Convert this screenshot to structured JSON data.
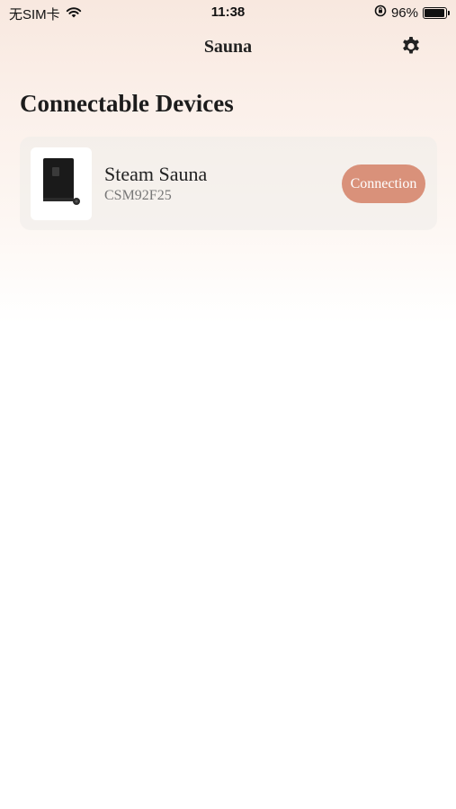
{
  "status_bar": {
    "carrier": "无SIM卡",
    "time": "11:38",
    "battery_text": "96%",
    "battery_level": 0.96
  },
  "nav": {
    "title": "Sauna",
    "settings_icon": "gear-icon"
  },
  "section": {
    "title": "Connectable Devices"
  },
  "devices": [
    {
      "name": "Steam Sauna",
      "id": "CSM92F25",
      "action_label": "Connection",
      "thumbnail_icon": "sauna-device-icon"
    }
  ],
  "colors": {
    "accent": "#d9917a",
    "background_top": "#f8e8df",
    "card": "#efedeb"
  }
}
